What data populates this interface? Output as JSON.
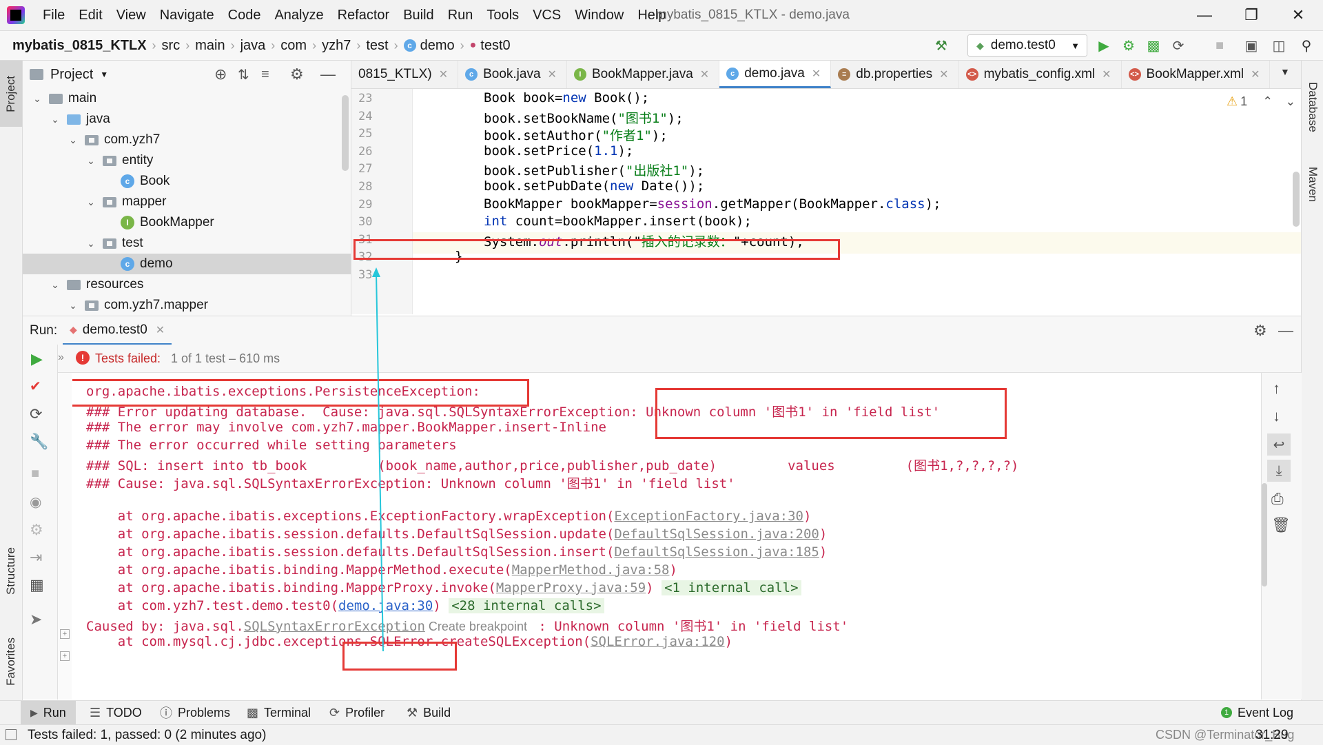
{
  "menubar": {
    "items": [
      "File",
      "Edit",
      "View",
      "Navigate",
      "Code",
      "Analyze",
      "Refactor",
      "Build",
      "Run",
      "Tools",
      "VCS",
      "Window",
      "Help"
    ],
    "window_title": "mybatis_0815_KTLX - demo.java"
  },
  "breadcrumb": {
    "items": [
      "mybatis_0815_KTLX",
      "src",
      "main",
      "java",
      "com",
      "yzh7",
      "test",
      "demo",
      "test0"
    ]
  },
  "run_config": {
    "label": "demo.test0"
  },
  "left_stripe": {
    "project": "Project",
    "structure": "Structure",
    "favorites": "Favorites"
  },
  "right_stripe": {
    "database": "Database",
    "maven": "Maven"
  },
  "project_panel": {
    "title": "Project",
    "tree": [
      {
        "label": "main",
        "kind": "folder",
        "level": 0,
        "expanded": true
      },
      {
        "label": "java",
        "kind": "folder-blue",
        "level": 1,
        "expanded": true
      },
      {
        "label": "com.yzh7",
        "kind": "package",
        "level": 2,
        "expanded": true
      },
      {
        "label": "entity",
        "kind": "package",
        "level": 3,
        "expanded": true
      },
      {
        "label": "Book",
        "kind": "class",
        "level": 4
      },
      {
        "label": "mapper",
        "kind": "package",
        "level": 3,
        "expanded": true
      },
      {
        "label": "BookMapper",
        "kind": "interface",
        "level": 4
      },
      {
        "label": "test",
        "kind": "package",
        "level": 3,
        "expanded": true
      },
      {
        "label": "demo",
        "kind": "class",
        "level": 4,
        "selected": true
      },
      {
        "label": "resources",
        "kind": "folder",
        "level": 1,
        "expanded": true
      },
      {
        "label": "com.yzh7.mapper",
        "kind": "package",
        "level": 2,
        "expanded": true
      }
    ]
  },
  "tabs": [
    {
      "label": "0815_KTLX)",
      "icon": "none"
    },
    {
      "label": "Book.java",
      "icon": "class-icon"
    },
    {
      "label": "BookMapper.java",
      "icon": "interface-icon"
    },
    {
      "label": "demo.java",
      "icon": "class-icon",
      "active": true
    },
    {
      "label": "db.properties",
      "icon": "properties-icon"
    },
    {
      "label": "mybatis_config.xml",
      "icon": "xml-icon"
    },
    {
      "label": "BookMapper.xml",
      "icon": "xml-icon"
    }
  ],
  "editor": {
    "warning_count": "1",
    "lines": [
      {
        "n": "23",
        "parts": [
          [
            "",
            "Book book="
          ],
          [
            "kw",
            "new"
          ],
          [
            "",
            " Book();"
          ]
        ]
      },
      {
        "n": "24",
        "parts": [
          [
            "",
            "book.setBookName("
          ],
          [
            "str",
            "\"图书1\""
          ],
          [
            "",
            ");"
          ]
        ]
      },
      {
        "n": "25",
        "parts": [
          [
            "",
            "book.setAuthor("
          ],
          [
            "str",
            "\"作者1\""
          ],
          [
            "",
            ");"
          ]
        ]
      },
      {
        "n": "26",
        "parts": [
          [
            "",
            "book.setPrice("
          ],
          [
            "kw",
            "1.1"
          ],
          [
            "",
            ");"
          ]
        ]
      },
      {
        "n": "27",
        "parts": [
          [
            "",
            "book.setPublisher("
          ],
          [
            "str",
            "\"出版社1\""
          ],
          [
            "",
            ");"
          ]
        ]
      },
      {
        "n": "28",
        "parts": [
          [
            "",
            "book.setPubDate("
          ],
          [
            "kw",
            "new"
          ],
          [
            "",
            " Date());"
          ]
        ]
      },
      {
        "n": "29",
        "parts": [
          [
            "",
            "BookMapper bookMapper="
          ],
          [
            "fld",
            "session"
          ],
          [
            "",
            ".getMapper(BookMapper."
          ],
          [
            "kw",
            "class"
          ],
          [
            "",
            ");"
          ]
        ]
      },
      {
        "n": "30",
        "parts": [
          [
            "kw",
            "int"
          ],
          [
            "",
            " count=bookMapper.insert(book);"
          ]
        ]
      },
      {
        "n": "31",
        "parts": [
          [
            "",
            "System."
          ],
          [
            "ital",
            "out"
          ],
          [
            "",
            ".println(\""
          ],
          [
            "str",
            "插入的记录数："
          ],
          [
            "",
            "\"+count);"
          ]
        ]
      },
      {
        "n": "32",
        "parts": [
          [
            "",
            "}"
          ]
        ],
        "indent": "outer"
      },
      {
        "n": "33",
        "parts": [
          [
            "",
            ""
          ]
        ]
      }
    ]
  },
  "run_panel": {
    "label": "Run:",
    "tab": "demo.test0",
    "status_failed": "Tests failed:",
    "status_rest": " 1 of 1 test – 610 ms"
  },
  "console": {
    "lines": [
      [
        [
          "",
          "org.apache.ibatis.exceptions.PersistenceException: "
        ]
      ],
      [
        [
          "",
          "### Error updating database.  Cause: java.sql.SQLSyntaxErrorException: Unknown column '图书1' in 'field list'"
        ]
      ],
      [
        [
          "",
          "### The error may involve com.yzh7.mapper.BookMapper.insert-Inline"
        ]
      ],
      [
        [
          "",
          "### The error occurred while setting parameters"
        ]
      ],
      [
        [
          "",
          "### SQL: insert into tb_book         (book_name,author,price,publisher,pub_date)         values         (图书1,?,?,?,?)"
        ]
      ],
      [
        [
          "",
          "### Cause: java.sql.SQLSyntaxErrorException: Unknown column '图书1' in 'field list'"
        ]
      ],
      [
        [
          "",
          ""
        ]
      ],
      [
        [
          "",
          "    at org.apache.ibatis.exceptions.ExceptionFactory.wrapException("
        ],
        [
          "lnk",
          "ExceptionFactory.java:30"
        ],
        [
          "",
          ")"
        ]
      ],
      [
        [
          "",
          "    at org.apache.ibatis.session.defaults.DefaultSqlSession.update("
        ],
        [
          "lnk",
          "DefaultSqlSession.java:200"
        ],
        [
          "",
          ")"
        ]
      ],
      [
        [
          "",
          "    at org.apache.ibatis.session.defaults.DefaultSqlSession.insert("
        ],
        [
          "lnk",
          "DefaultSqlSession.java:185"
        ],
        [
          "",
          ")"
        ]
      ],
      [
        [
          "",
          "    at org.apache.ibatis.binding.MapperMethod.execute("
        ],
        [
          "lnk",
          "MapperMethod.java:58"
        ],
        [
          "",
          ")"
        ]
      ],
      [
        [
          "",
          "    at org.apache.ibatis.binding.MapperProxy.invoke("
        ],
        [
          "lnk",
          "MapperProxy.java:59"
        ],
        [
          "",
          ") "
        ],
        [
          "int",
          "<1 internal call>"
        ]
      ],
      [
        [
          "",
          "    at com.yzh7.test.demo.test0("
        ],
        [
          "lnk2",
          "demo.java:30"
        ],
        [
          "",
          ") "
        ],
        [
          "int",
          "<28 internal calls>"
        ]
      ],
      [
        [
          "",
          "Caused by: java.sql."
        ],
        [
          "lnk",
          "SQLSyntaxErrorException"
        ],
        [
          "bp",
          " Create breakpoint "
        ],
        [
          "",
          " : Unknown column '图书1' in 'field list'"
        ]
      ],
      [
        [
          "",
          "    at com.mysql.cj.jdbc.exceptions.SQLError.createSQLException("
        ],
        [
          "lnk",
          "SQLError.java:120"
        ],
        [
          "",
          ")"
        ]
      ]
    ]
  },
  "bottom_tools": {
    "run": "Run",
    "todo": "TODO",
    "problems": "Problems",
    "terminal": "Terminal",
    "profiler": "Profiler",
    "build": "Build",
    "event_log": "Event Log"
  },
  "statusbar": {
    "message": "Tests failed: 1, passed: 0 (2 minutes ago)",
    "position": "31:29",
    "watermark": "CSDN @Terminator_Bug"
  },
  "colors": {
    "accent": "#4083c9",
    "error": "#e53935",
    "annotation_arrow": "#26c6da"
  }
}
